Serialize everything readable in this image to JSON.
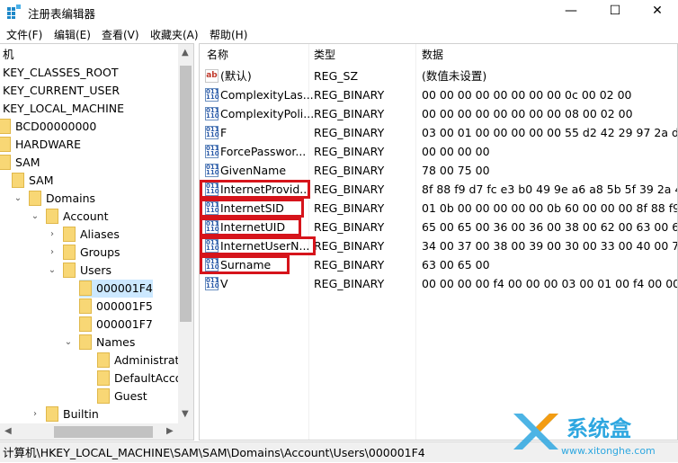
{
  "window": {
    "title": "注册表编辑器",
    "minimize": "—",
    "maximize": "☐",
    "close": "✕"
  },
  "menu": [
    "文件(F)",
    "编辑(E)",
    "查看(V)",
    "收藏夹(A)",
    "帮助(H)"
  ],
  "tree": [
    {
      "label": "机",
      "level": -1,
      "expander": "",
      "folder": false
    },
    {
      "label": "KEY_CLASSES_ROOT",
      "level": -1,
      "expander": "",
      "folder": false
    },
    {
      "label": "KEY_CURRENT_USER",
      "level": -1,
      "expander": "",
      "folder": false
    },
    {
      "label": "KEY_LOCAL_MACHINE",
      "level": -1,
      "expander": "",
      "folder": false
    },
    {
      "label": "BCD00000000",
      "level": 0,
      "expander": "",
      "folder": true
    },
    {
      "label": "HARDWARE",
      "level": 0,
      "expander": "",
      "folder": true
    },
    {
      "label": "SAM",
      "level": 0,
      "expander": "",
      "folder": true
    },
    {
      "label": "SAM",
      "level": 1,
      "expander": "",
      "folder": true
    },
    {
      "label": "Domains",
      "level": 2,
      "expander": "v",
      "folder": true
    },
    {
      "label": "Account",
      "level": 3,
      "expander": "v",
      "folder": true
    },
    {
      "label": "Aliases",
      "level": 4,
      "expander": ">",
      "folder": true
    },
    {
      "label": "Groups",
      "level": 4,
      "expander": ">",
      "folder": true
    },
    {
      "label": "Users",
      "level": 4,
      "expander": "v",
      "folder": true
    },
    {
      "label": "000001F4",
      "level": 5,
      "expander": "",
      "folder": true,
      "selected": true
    },
    {
      "label": "000001F5",
      "level": 5,
      "expander": "",
      "folder": true
    },
    {
      "label": "000001F7",
      "level": 5,
      "expander": "",
      "folder": true
    },
    {
      "label": "Names",
      "level": 5,
      "expander": "v",
      "folder": true
    },
    {
      "label": "Administrato",
      "level": 6,
      "expander": "",
      "folder": true
    },
    {
      "label": "DefaultAccou",
      "level": 6,
      "expander": "",
      "folder": true
    },
    {
      "label": "Guest",
      "level": 6,
      "expander": "",
      "folder": true
    },
    {
      "label": "Builtin",
      "level": 3,
      "expander": ">",
      "folder": true
    }
  ],
  "list": {
    "headers": {
      "name": "名称",
      "type": "类型",
      "data": "数据"
    },
    "rows": [
      {
        "icon": "ab",
        "name": "(默认)",
        "type": "REG_SZ",
        "data": "(数值未设置)"
      },
      {
        "icon": "bin",
        "name": "ComplexityLas...",
        "type": "REG_BINARY",
        "data": "00 00 00 00 00 00 00 00 0c 00 02 00"
      },
      {
        "icon": "bin",
        "name": "ComplexityPoli...",
        "type": "REG_BINARY",
        "data": "00 00 00 00 00 00 00 00 08 00 02 00"
      },
      {
        "icon": "bin",
        "name": "F",
        "type": "REG_BINARY",
        "data": "03 00 01 00 00 00 00 00 55 d2 42 29 97 2a d..."
      },
      {
        "icon": "bin",
        "name": "ForcePasswor...",
        "type": "REG_BINARY",
        "data": "00 00 00 00"
      },
      {
        "icon": "bin",
        "name": "GivenName",
        "type": "REG_BINARY",
        "data": "78 00 75 00"
      },
      {
        "icon": "bin",
        "name": "InternetProvid...",
        "type": "REG_BINARY",
        "data": "8f 88 f9 d7 fc e3 b0 49 9e a6 a8 5b 5f 39 2a 4f",
        "highlight": true
      },
      {
        "icon": "bin",
        "name": "InternetSID",
        "type": "REG_BINARY",
        "data": "01 0b 00 00 00 00 00 0b 60 00 00 00 8f 88 f9...",
        "highlight": true
      },
      {
        "icon": "bin",
        "name": "InternetUID",
        "type": "REG_BINARY",
        "data": "65 00 65 00 36 00 36 00 38 00 62 00 63 00 6...",
        "highlight": true
      },
      {
        "icon": "bin",
        "name": "InternetUserN...",
        "type": "REG_BINARY",
        "data": "34 00 37 00 38 00 39 00 30 00 33 00 40 00 7...",
        "highlight": true
      },
      {
        "icon": "bin",
        "name": "Surname",
        "type": "REG_BINARY",
        "data": "63 00 65 00",
        "highlight": true
      },
      {
        "icon": "bin",
        "name": "V",
        "type": "REG_BINARY",
        "data": "00 00 00 00 f4 00 00 00 03 00 01 00 f4 00 00 ..."
      }
    ]
  },
  "highlight_color": "#d6141b",
  "status": "计算机\\HKEY_LOCAL_MACHINE\\SAM\\SAM\\Domains\\Account\\Users\\000001F4",
  "watermark": {
    "title": "系统盒",
    "url": "www.xitonghe.com"
  }
}
